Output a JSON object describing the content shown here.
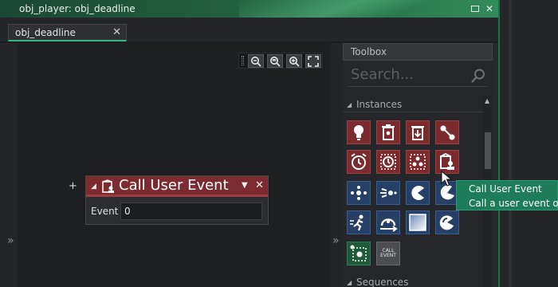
{
  "window": {
    "title": "obj_player: obj_deadline",
    "controls": [
      "maximize-icon",
      "close-icon"
    ],
    "accent": "#36b37e"
  },
  "tabs": [
    {
      "label": "obj_deadline",
      "close": "✕"
    }
  ],
  "canvas": {
    "expand_glyph": "»",
    "zoom_tools": [
      "zoom-reset-icon",
      "zoom-out-icon",
      "zoom-in-icon",
      "fit-screen-icon"
    ],
    "add_glyph": "+",
    "event_block": {
      "title": "Call User Event",
      "color": "#7c2b30",
      "collapse_glyph": "◢",
      "menu_glyph": "▼",
      "close_glyph": "✕",
      "field_label": "Event",
      "field_value": "0"
    }
  },
  "divider": {
    "expand_glyph": "»"
  },
  "toolbox": {
    "header": "Toolbox",
    "search_placeholder": "Search...",
    "sections": [
      {
        "label": "Instances",
        "collapse_glyph": "◢"
      },
      {
        "label": "Sequences",
        "collapse_glyph": "◢"
      }
    ],
    "tiles": [
      {
        "icon": "create-instance-icon",
        "color": "red"
      },
      {
        "icon": "destroy-instance-icon",
        "color": "red"
      },
      {
        "icon": "destroy-at-position-icon",
        "color": "red"
      },
      {
        "icon": "change-instance-icon",
        "color": "red"
      },
      {
        "icon": "set-alarm-icon",
        "color": "red"
      },
      {
        "icon": "get-alarm-icon",
        "color": "red"
      },
      {
        "icon": "instance-count-icon",
        "color": "red"
      },
      {
        "icon": "call-user-event-icon",
        "color": "red"
      },
      {
        "icon": "set-instance-variable-icon",
        "color": "blue"
      },
      {
        "icon": "get-instance-variable-icon",
        "color": "blue"
      },
      {
        "icon": "pacman-icon",
        "color": "blue"
      },
      {
        "icon": "pacman-angled-icon",
        "color": "blue"
      },
      {
        "icon": "runner-icon",
        "color": "blue"
      },
      {
        "icon": "jump-icon",
        "color": "blue"
      },
      {
        "icon": "sprite-gradient-icon",
        "color": "blue"
      },
      {
        "icon": "pacman-swirl-icon",
        "color": "blue"
      },
      {
        "icon": "instance-selection-icon",
        "color": "green"
      },
      {
        "icon": "call-event-text-icon",
        "color": "gray",
        "text": "CALL EVENT"
      }
    ]
  },
  "tooltip": {
    "title": "Call User Event",
    "description": "Call a user event on"
  }
}
